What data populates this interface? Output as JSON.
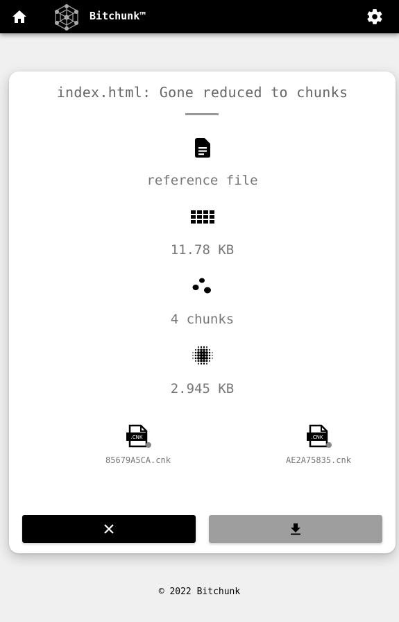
{
  "header": {
    "brand": "Bitchunk™",
    "icons": {
      "home": "home-icon",
      "logo": "bitchunk-logo",
      "settings": "gear-icon"
    }
  },
  "card": {
    "title": "index.html: Gone reduced to chunks",
    "stats": [
      {
        "icon": "document-icon",
        "text": "reference file"
      },
      {
        "icon": "grid-icon",
        "text": "11.78 KB"
      },
      {
        "icon": "scatter-dots-icon",
        "text": "4 chunks"
      },
      {
        "icon": "halftone-icon",
        "text": "2.945 KB"
      }
    ],
    "chunks": [
      {
        "icon": "cnk-file-icon",
        "badge": ".CNK",
        "name": "85679A5CA.cnk"
      },
      {
        "icon": "cnk-file-icon",
        "badge": ".CNK",
        "name": "AE2A75835.cnk"
      }
    ],
    "buttons": {
      "close": "close-icon",
      "download": "download-icon"
    }
  },
  "footer": {
    "text": "© 2022 Bitchunk"
  },
  "colors": {
    "topbar": "#000000",
    "card": "#ffffff",
    "close_button": "#000000",
    "download_button": "#9e9e9e",
    "muted_text": "#777777"
  }
}
